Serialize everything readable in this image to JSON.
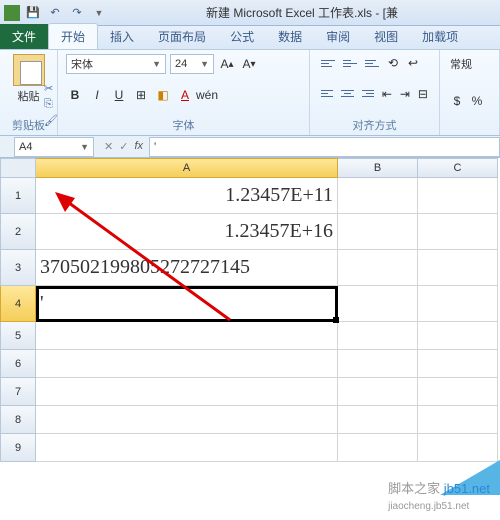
{
  "titlebar": {
    "title": "新建 Microsoft Excel 工作表.xls - [兼"
  },
  "tabs": {
    "file": "文件",
    "home": "开始",
    "insert": "插入",
    "layout": "页面布局",
    "formulas": "公式",
    "data": "数据",
    "review": "审阅",
    "view": "视图",
    "addins": "加载项"
  },
  "ribbon": {
    "clipboard": {
      "paste": "粘贴",
      "label": "剪贴板"
    },
    "font": {
      "name": "宋体",
      "size": "24",
      "label": "字体"
    },
    "align": {
      "label": "对齐方式"
    },
    "number": {
      "general": "常规"
    }
  },
  "formula_bar": {
    "name_box": "A4",
    "value": "'"
  },
  "cells": {
    "A1": "1.23457E+11",
    "A2": "1.23457E+16",
    "A3": "370502199805272727145",
    "A4": "'"
  },
  "columns": {
    "A": "A",
    "B": "B",
    "C": "C"
  },
  "rows": {
    "1": "1",
    "2": "2",
    "3": "3",
    "4": "4",
    "5": "5",
    "6": "6",
    "7": "7",
    "8": "8",
    "9": "9"
  },
  "watermark": {
    "text1": "脚本之家 ",
    "text2": "jb51.net",
    "sub": "jiaocheng.jb51.net"
  }
}
